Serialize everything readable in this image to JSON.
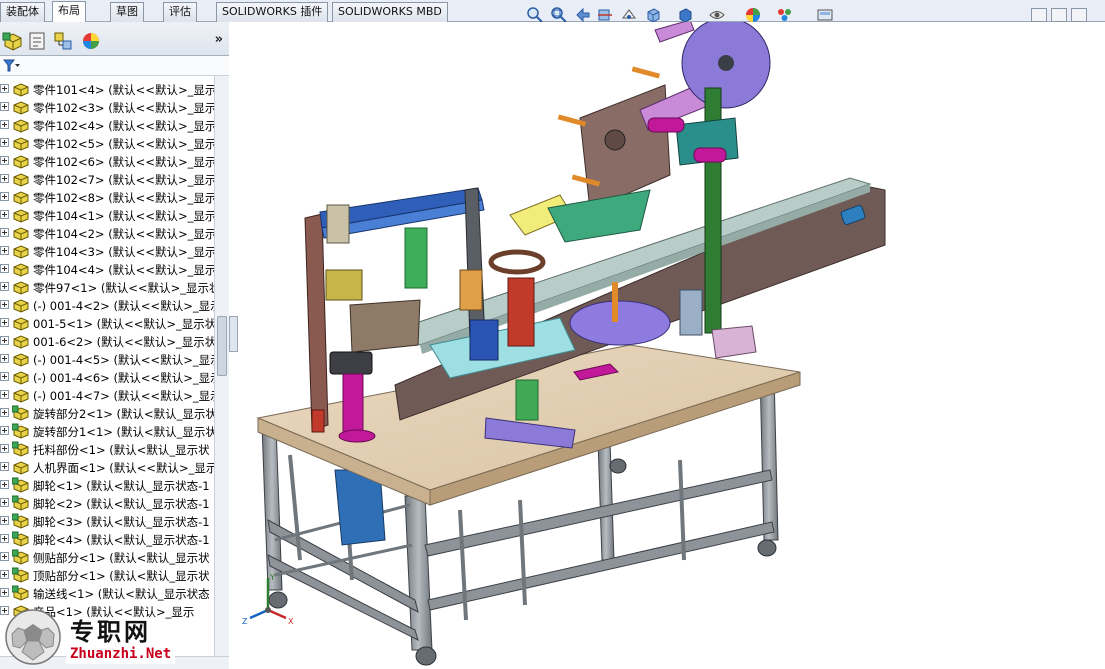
{
  "command_tabs": [
    {
      "label": "装配体",
      "active": false
    },
    {
      "label": "布局",
      "active": true
    },
    {
      "label": "草图",
      "active": false
    },
    {
      "label": "评估",
      "active": false
    },
    {
      "label": "SOLIDWORKS 插件",
      "active": false
    },
    {
      "label": "SOLIDWORKS MBD",
      "active": false
    }
  ],
  "heads_up_toolbar": [
    "zoom-to-fit-icon",
    "zoom-to-area-icon",
    "previous-view-icon",
    "section-view-icon",
    "dynamic-annotation-icon",
    "view-orientation-icon",
    "display-style-icon",
    "hide-show-icon",
    "edit-appearance-icon",
    "apply-scene-icon",
    "view-settings-icon"
  ],
  "feature_manager": {
    "panel_tabs": [
      "featuremanager-icon",
      "propertymanager-icon",
      "configurationmanager-icon",
      "displaymanager-icon"
    ],
    "more_label": "»",
    "tree_items": [
      {
        "label": "零件101<4> (默认<<默认>_显示",
        "icon": "part-icon"
      },
      {
        "label": "零件102<3> (默认<<默认>_显示",
        "icon": "part-icon"
      },
      {
        "label": "零件102<4> (默认<<默认>_显示",
        "icon": "part-icon"
      },
      {
        "label": "零件102<5> (默认<<默认>_显示",
        "icon": "part-icon"
      },
      {
        "label": "零件102<6> (默认<<默认>_显示",
        "icon": "part-icon"
      },
      {
        "label": "零件102<7> (默认<<默认>_显示",
        "icon": "part-icon"
      },
      {
        "label": "零件102<8> (默认<<默认>_显示",
        "icon": "part-icon"
      },
      {
        "label": "零件104<1> (默认<<默认>_显示",
        "icon": "part-icon"
      },
      {
        "label": "零件104<2> (默认<<默认>_显示",
        "icon": "part-icon"
      },
      {
        "label": "零件104<3> (默认<<默认>_显示",
        "icon": "part-icon"
      },
      {
        "label": "零件104<4> (默认<<默认>_显示",
        "icon": "part-icon"
      },
      {
        "label": "零件97<1> (默认<<默认>_显示状",
        "icon": "part-icon"
      },
      {
        "label": "(-) 001-4<2> (默认<<默认>_显示",
        "icon": "part-icon"
      },
      {
        "label": "001-5<1> (默认<<默认>_显示状",
        "icon": "part-icon"
      },
      {
        "label": "001-6<2> (默认<<默认>_显示状",
        "icon": "part-icon"
      },
      {
        "label": "(-) 001-4<5> (默认<<默认>_显示",
        "icon": "part-icon"
      },
      {
        "label": "(-) 001-4<6> (默认<<默认>_显示",
        "icon": "part-icon"
      },
      {
        "label": "(-) 001-4<7> (默认<<默认>_显示",
        "icon": "part-icon"
      },
      {
        "label": "旋转部分2<1> (默认<默认_显示状",
        "icon": "assembly-icon"
      },
      {
        "label": "旋转部分1<1> (默认<默认_显示状",
        "icon": "assembly-icon"
      },
      {
        "label": "托料部份<1> (默认<默认_显示状",
        "icon": "assembly-icon"
      },
      {
        "label": "人机界面<1> (默认<<默认>_显示",
        "icon": "part-icon"
      },
      {
        "label": "脚轮<1> (默认<默认_显示状态-1",
        "icon": "assembly-icon"
      },
      {
        "label": "脚轮<2> (默认<默认_显示状态-1",
        "icon": "assembly-icon"
      },
      {
        "label": "脚轮<3> (默认<默认_显示状态-1",
        "icon": "assembly-icon"
      },
      {
        "label": "脚轮<4> (默认<默认_显示状态-1",
        "icon": "assembly-icon"
      },
      {
        "label": "侧贴部分<1> (默认<默认_显示状",
        "icon": "assembly-icon"
      },
      {
        "label": "顶贴部分<1> (默认<默认_显示状",
        "icon": "assembly-icon"
      },
      {
        "label": "输送线<1> (默认<默认_显示状态",
        "icon": "assembly-icon"
      },
      {
        "label": "产品<1> (默认<<默认>_显示",
        "icon": "part-icon"
      }
    ]
  },
  "watermark": {
    "cn": "专职网",
    "en": "Zhuanzhi.Net"
  },
  "triad_axes": {
    "x": "X",
    "y": "Y",
    "z": "Z"
  },
  "colors": {
    "frame": "#8d9399",
    "table_top": "#e6d3b8",
    "conveyor": "#6f5a55",
    "belt": "#b8ccc8",
    "accent_green": "#2e7d32",
    "magenta": "#c2189a"
  }
}
